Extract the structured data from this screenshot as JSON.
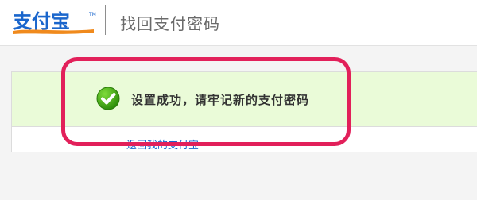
{
  "header": {
    "logo_text": "支付宝",
    "logo_trademark": "TM",
    "page_title": "找回支付密码"
  },
  "result": {
    "message": "设置成功，请牢记新的支付密码",
    "back_link": "返回我的支付宝"
  },
  "colors": {
    "logo_blue": "#1a66cc",
    "logo_orange": "#f08a1d",
    "success_bg": "#eafbd8",
    "check_green": "#3aa50f",
    "highlight_red": "#e2205a",
    "link_blue": "#1a66cc"
  },
  "icons": {
    "check": "check-circle-icon"
  }
}
